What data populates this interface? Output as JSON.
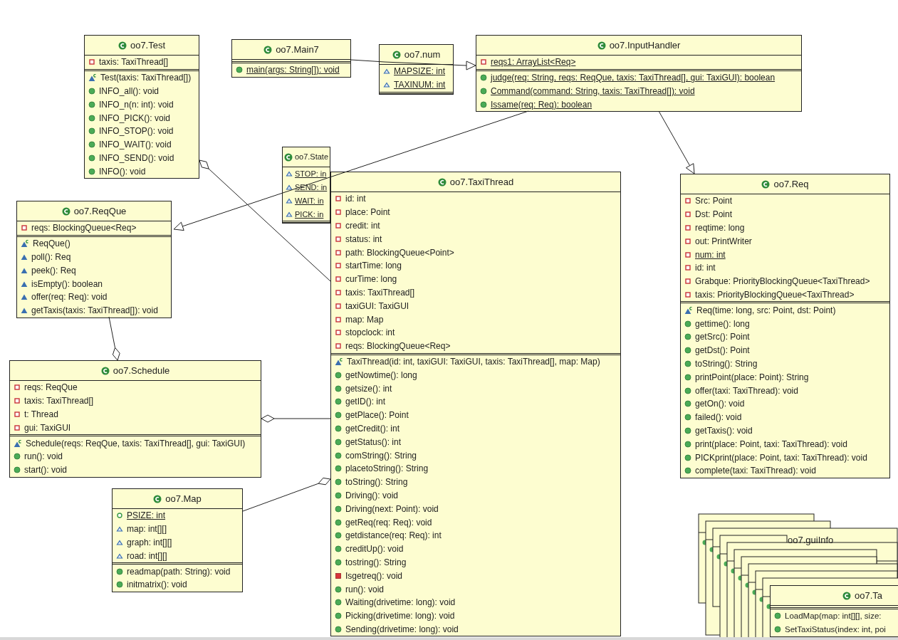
{
  "classes": [
    {
      "name": "oo7.Test",
      "attributes": [
        {
          "text": "taxis: TaxiThread[]",
          "kind": "private",
          "static": false
        }
      ],
      "operations": [
        {
          "text": "Test(taxis: TaxiThread[])",
          "kind": "constructor",
          "static": false
        },
        {
          "text": "INFO_all(): void",
          "kind": "public",
          "static": false
        },
        {
          "text": "INFO_n(n: int): void",
          "kind": "public",
          "static": false
        },
        {
          "text": "INFO_PICK(): void",
          "kind": "public",
          "static": false
        },
        {
          "text": "INFO_STOP(): void",
          "kind": "public",
          "static": false
        },
        {
          "text": "INFO_WAIT(): void",
          "kind": "public",
          "static": false
        },
        {
          "text": "INFO_SEND(): void",
          "kind": "public",
          "static": false
        },
        {
          "text": "INFO(): void",
          "kind": "public",
          "static": false
        }
      ]
    },
    {
      "name": "oo7.Main7",
      "operations": [
        {
          "text": "main(args: String[]): void",
          "kind": "public",
          "static": true
        }
      ]
    },
    {
      "name": "oo7.num",
      "attributes": [
        {
          "text": "MAPSIZE: int",
          "kind": "package",
          "static": true
        },
        {
          "text": "TAXINUM: int",
          "kind": "package",
          "static": true
        }
      ]
    },
    {
      "name": "oo7.InputHandler",
      "attributes": [
        {
          "text": "reqs1: ArrayList<Req>",
          "kind": "private",
          "static": true
        }
      ],
      "operations": [
        {
          "text": "judge(req: String, reqs: ReqQue, taxis: TaxiThread[], gui: TaxiGUI): boolean",
          "kind": "public",
          "static": true
        },
        {
          "text": "Command(command: String, taxis: TaxiThread[]): void",
          "kind": "public",
          "static": true
        },
        {
          "text": "Issame(req: Req): boolean",
          "kind": "public",
          "static": true
        }
      ]
    },
    {
      "name": "oo7.ReqQue",
      "attributes": [
        {
          "text": "reqs: BlockingQueue<Req>",
          "kind": "private",
          "static": false
        }
      ],
      "operations": [
        {
          "text": "ReqQue()",
          "kind": "constructor",
          "static": false
        },
        {
          "text": "poll(): Req",
          "kind": "package",
          "static": false
        },
        {
          "text": "peek(): Req",
          "kind": "package",
          "static": false
        },
        {
          "text": "isEmpty(): boolean",
          "kind": "package",
          "static": false
        },
        {
          "text": "offer(req: Req): void",
          "kind": "package",
          "static": false
        },
        {
          "text": "getTaxis(taxis: TaxiThread[]): void",
          "kind": "package",
          "static": false
        }
      ]
    },
    {
      "name": "oo7.Schedule",
      "attributes": [
        {
          "text": "reqs: ReqQue",
          "kind": "private",
          "static": false
        },
        {
          "text": "taxis: TaxiThread[]",
          "kind": "private",
          "static": false
        },
        {
          "text": "t: Thread",
          "kind": "private",
          "static": false
        },
        {
          "text": "gui: TaxiGUI",
          "kind": "private",
          "static": false
        }
      ],
      "operations": [
        {
          "text": "Schedule(reqs: ReqQue, taxis: TaxiThread[], gui: TaxiGUI)",
          "kind": "constructor",
          "static": false
        },
        {
          "text": "run(): void",
          "kind": "public",
          "static": false
        },
        {
          "text": "start(): void",
          "kind": "public",
          "static": false
        }
      ]
    },
    {
      "name": "oo7.Map",
      "attributes": [
        {
          "text": "PSIZE: int",
          "kind": "public",
          "static": true
        },
        {
          "text": "map: int[][]",
          "kind": "package",
          "static": false
        },
        {
          "text": "graph: int[][]",
          "kind": "package",
          "static": false
        },
        {
          "text": "road: int[][]",
          "kind": "package",
          "static": false
        }
      ],
      "operations": [
        {
          "text": "readmap(path: String): void",
          "kind": "public",
          "static": false
        },
        {
          "text": "initmatrix(): void",
          "kind": "public",
          "static": false
        }
      ]
    },
    {
      "name": "oo7.State",
      "attributes": [
        {
          "text": "STOP: in",
          "kind": "package",
          "static": true
        },
        {
          "text": "SEND: in",
          "kind": "package",
          "static": true
        },
        {
          "text": "WAIT: in",
          "kind": "package",
          "static": true
        },
        {
          "text": "PICK: in",
          "kind": "package",
          "static": true
        }
      ]
    },
    {
      "name": "oo7.TaxiThread",
      "attributes": [
        {
          "text": "id: int",
          "kind": "private",
          "static": false
        },
        {
          "text": "place: Point",
          "kind": "private",
          "static": false
        },
        {
          "text": "credit: int",
          "kind": "private",
          "static": false
        },
        {
          "text": "status: int",
          "kind": "private",
          "static": false
        },
        {
          "text": "path: BlockingQueue<Point>",
          "kind": "private",
          "static": false
        },
        {
          "text": "startTime: long",
          "kind": "private",
          "static": false
        },
        {
          "text": "curTime: long",
          "kind": "private",
          "static": false
        },
        {
          "text": "taxis: TaxiThread[]",
          "kind": "private",
          "static": false
        },
        {
          "text": "taxiGUI: TaxiGUI",
          "kind": "private",
          "static": false
        },
        {
          "text": "map: Map",
          "kind": "private",
          "static": false
        },
        {
          "text": "stopclock: int",
          "kind": "private",
          "static": false
        },
        {
          "text": "reqs: BlockingQueue<Req>",
          "kind": "private",
          "static": false
        }
      ],
      "operations": [
        {
          "text": "TaxiThread(id: int, taxiGUI: TaxiGUI, taxis: TaxiThread[], map: Map)",
          "kind": "constructor",
          "static": false
        },
        {
          "text": "getNowtime(): long",
          "kind": "public",
          "static": false
        },
        {
          "text": "getsize(): int",
          "kind": "public",
          "static": false
        },
        {
          "text": "getID(): int",
          "kind": "public",
          "static": false
        },
        {
          "text": "getPlace(): Point",
          "kind": "public",
          "static": false
        },
        {
          "text": "getCredit(): int",
          "kind": "public",
          "static": false
        },
        {
          "text": "getStatus(): int",
          "kind": "public",
          "static": false
        },
        {
          "text": "comString(): String",
          "kind": "public",
          "static": false
        },
        {
          "text": "placetoString(): String",
          "kind": "public",
          "static": false
        },
        {
          "text": "toString(): String",
          "kind": "public",
          "static": false
        },
        {
          "text": "Driving(): void",
          "kind": "public",
          "static": false
        },
        {
          "text": "Driving(next: Point): void",
          "kind": "public",
          "static": false
        },
        {
          "text": "getReq(req: Req): void",
          "kind": "public",
          "static": false
        },
        {
          "text": "getdistance(req: Req): int",
          "kind": "public",
          "static": false
        },
        {
          "text": "creditUp(): void",
          "kind": "public",
          "static": false
        },
        {
          "text": "tostring(): String",
          "kind": "public",
          "static": false
        },
        {
          "text": "Isgetreq(): void",
          "kind": "private",
          "static": false
        },
        {
          "text": "run(): void",
          "kind": "public",
          "static": false
        },
        {
          "text": "Waiting(drivetime: long): void",
          "kind": "public",
          "static": false
        },
        {
          "text": "Picking(drivetime: long): void",
          "kind": "public",
          "static": false
        },
        {
          "text": "Sending(drivetime: long): void",
          "kind": "public",
          "static": false
        }
      ]
    },
    {
      "name": "oo7.Req",
      "attributes": [
        {
          "text": "Src: Point",
          "kind": "private",
          "static": false
        },
        {
          "text": "Dst: Point",
          "kind": "private",
          "static": false
        },
        {
          "text": "reqtime: long",
          "kind": "private",
          "static": false
        },
        {
          "text": "out: PrintWriter",
          "kind": "private",
          "static": false
        },
        {
          "text": "num: int",
          "kind": "private",
          "static": true
        },
        {
          "text": "id: int",
          "kind": "private",
          "static": false
        },
        {
          "text": "Grabque: PriorityBlockingQueue<TaxiThread>",
          "kind": "private",
          "static": false
        },
        {
          "text": "taxis: PriorityBlockingQueue<TaxiThread>",
          "kind": "private",
          "static": false
        }
      ],
      "operations": [
        {
          "text": "Req(time: long, src: Point, dst: Point)",
          "kind": "constructor",
          "static": false
        },
        {
          "text": "gettime(): long",
          "kind": "public",
          "static": false
        },
        {
          "text": "getSrc(): Point",
          "kind": "public",
          "static": false
        },
        {
          "text": "getDst(): Point",
          "kind": "public",
          "static": false
        },
        {
          "text": "toString(): String",
          "kind": "public",
          "static": false
        },
        {
          "text": "printPoint(place: Point): String",
          "kind": "public",
          "static": false
        },
        {
          "text": "offer(taxi: TaxiThread): void",
          "kind": "public",
          "static": false
        },
        {
          "text": "getOn(): void",
          "kind": "public",
          "static": false
        },
        {
          "text": "failed(): void",
          "kind": "public",
          "static": false
        },
        {
          "text": "getTaxis(): void",
          "kind": "public",
          "static": false
        },
        {
          "text": "print(place: Point, taxi: TaxiThread): void",
          "kind": "public",
          "static": false
        },
        {
          "text": "PICKprint(place: Point, taxi: TaxiThread): void",
          "kind": "public",
          "static": false
        },
        {
          "text": "complete(taxi: TaxiThread): void",
          "kind": "public",
          "static": false
        }
      ]
    }
  ],
  "stacked_classes": [
    {
      "name": "oo7.guiInfo"
    },
    {
      "name": "oo7.Ta",
      "operations": [
        {
          "text": "LoadMap(map: int[][], size:",
          "kind": "public",
          "static": false
        },
        {
          "text": "SetTaxiStatus(index: int, poi",
          "kind": "public",
          "static": false
        }
      ]
    }
  ]
}
